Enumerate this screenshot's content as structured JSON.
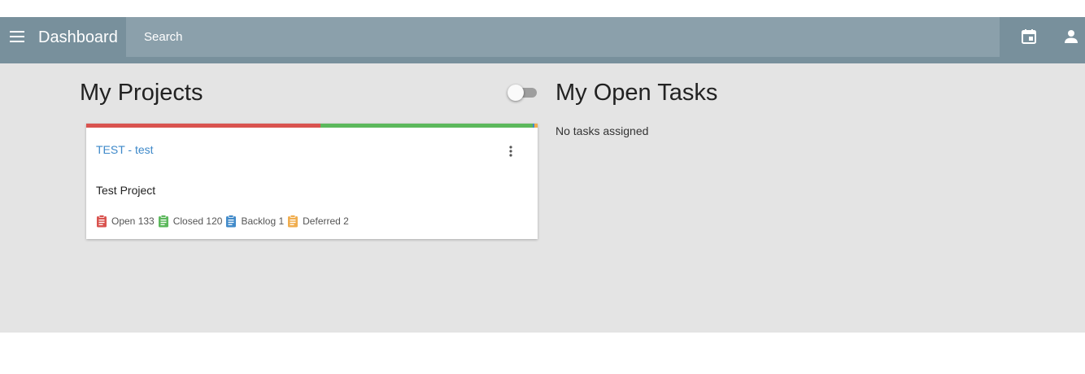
{
  "header": {
    "title": "Dashboard",
    "search_placeholder": "Search",
    "menu_icon": "menu-icon",
    "calendar_icon": "calendar-icon",
    "account_icon": "account-icon",
    "background_color": "#78909c"
  },
  "projects": {
    "title": "My Projects",
    "show_all_toggle": {
      "on": false
    },
    "cards": [
      {
        "name": "TEST - test",
        "description": "Test Project",
        "more_icon": "more-vert-icon",
        "progress": [
          {
            "status": "open",
            "fraction": 0.5215,
            "color": "#d9534f"
          },
          {
            "status": "closed",
            "fraction": 0.4706,
            "color": "#5cb85c"
          },
          {
            "status": "backlog",
            "fraction": 0.0039,
            "color": "#428bca"
          },
          {
            "status": "deferred",
            "fraction": 0.0078,
            "color": "#f0ad4e"
          }
        ],
        "stats": [
          {
            "label": "Open 133",
            "icon": "clipboard-icon",
            "color": "#d9534f"
          },
          {
            "label": "Closed 120",
            "icon": "clipboard-icon",
            "color": "#5cb85c"
          },
          {
            "label": "Backlog 1",
            "icon": "clipboard-icon",
            "color": "#428bca"
          },
          {
            "label": "Deferred 2",
            "icon": "clipboard-icon",
            "color": "#f0ad4e"
          }
        ]
      }
    ]
  },
  "tasks": {
    "title": "My Open Tasks",
    "empty_text": "No tasks assigned"
  }
}
